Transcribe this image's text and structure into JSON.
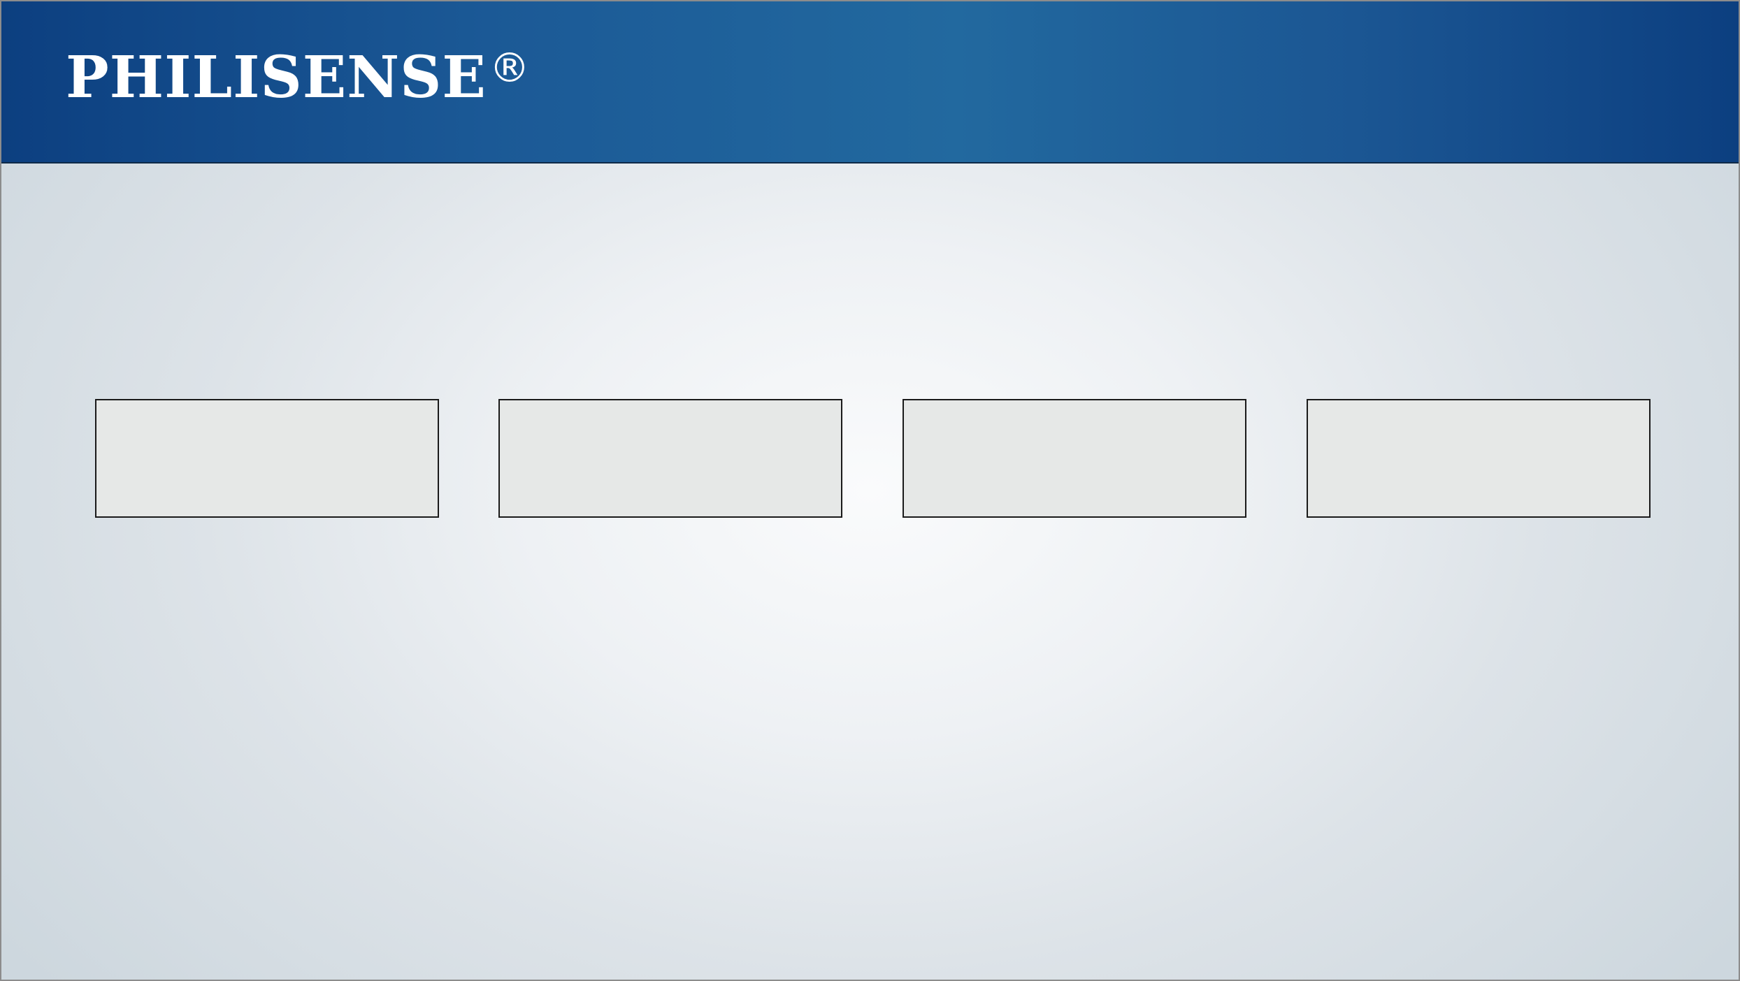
{
  "header": {
    "brand": "PHILISENSE",
    "registered_mark": "®"
  },
  "colors": {
    "header_dark": "#0c3f80",
    "header_light": "#22699f",
    "background_center": "#fafbfc",
    "background_edge": "#cdd7de",
    "box_fill": "#e6e8e7",
    "box_border": "#1a1a1a"
  },
  "boxes": [
    "",
    "",
    "",
    ""
  ]
}
